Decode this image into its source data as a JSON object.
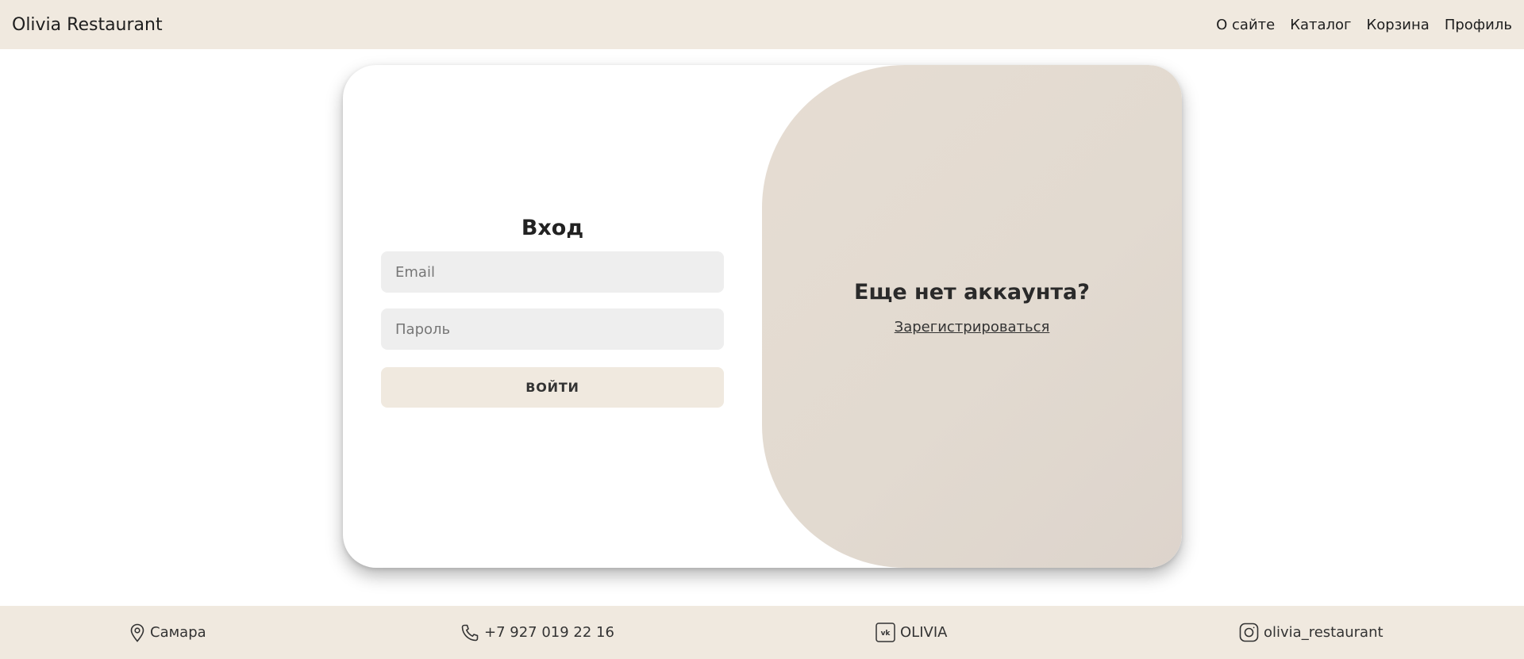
{
  "header": {
    "brand": "Olivia Restaurant",
    "nav": [
      "О сайте",
      "Каталог",
      "Корзина",
      "Профиль"
    ]
  },
  "login": {
    "title": "Вход",
    "email_placeholder": "Email",
    "password_placeholder": "Пароль",
    "submit_label": "ВОЙТИ"
  },
  "register": {
    "title": "Еще нет аккаунта?",
    "link_label": "Зарегистрироваться"
  },
  "footer": {
    "city": "Самара",
    "phone": "+7 927 019 22 16",
    "vk": "OLIVIA",
    "instagram": "olivia_restaurant"
  },
  "colors": {
    "header_bg": "#f0e9df",
    "panel_bg": "#e3dbd1",
    "input_bg": "#eeeeee"
  },
  "icons": [
    "location-pin-icon",
    "phone-icon",
    "vk-icon",
    "instagram-icon"
  ]
}
